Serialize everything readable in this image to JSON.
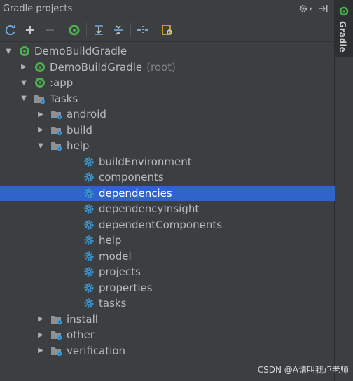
{
  "title": "Gradle projects",
  "side_tab": {
    "label": "Gradle"
  },
  "toolbar": {
    "buttons": [
      {
        "icon": "refresh-icon",
        "enabled": true
      },
      {
        "icon": "add-icon",
        "enabled": true
      },
      {
        "icon": "remove-icon",
        "enabled": false
      },
      {
        "icon": "execute-task-icon",
        "enabled": true
      },
      {
        "icon": "expand-all-icon",
        "enabled": true
      },
      {
        "icon": "collapse-all-icon",
        "enabled": true
      },
      {
        "icon": "offline-mode-icon",
        "enabled": true
      },
      {
        "icon": "settings-icon",
        "enabled": true
      }
    ]
  },
  "tree": [
    {
      "label": "DemoBuildGradle",
      "level": 0,
      "type": "gradle",
      "arrow": "expanded"
    },
    {
      "label": "DemoBuildGradle",
      "suffix": "(root)",
      "level": 1,
      "type": "gradle",
      "arrow": "collapsed"
    },
    {
      "label": ":app",
      "level": 1,
      "type": "gradle",
      "arrow": "expanded"
    },
    {
      "label": "Tasks",
      "level": 2,
      "type": "folder",
      "arrow": "expanded"
    },
    {
      "label": "android",
      "level": 3,
      "type": "folder",
      "arrow": "collapsed"
    },
    {
      "label": "build",
      "level": 3,
      "type": "folder",
      "arrow": "collapsed"
    },
    {
      "label": "help",
      "level": 3,
      "type": "folder",
      "arrow": "expanded"
    },
    {
      "label": "buildEnvironment",
      "level": 4,
      "type": "task"
    },
    {
      "label": "components",
      "level": 4,
      "type": "task"
    },
    {
      "label": "dependencies",
      "level": 4,
      "type": "task",
      "selected": true
    },
    {
      "label": "dependencyInsight",
      "level": 4,
      "type": "task"
    },
    {
      "label": "dependentComponents",
      "level": 4,
      "type": "task"
    },
    {
      "label": "help",
      "level": 4,
      "type": "task"
    },
    {
      "label": "model",
      "level": 4,
      "type": "task"
    },
    {
      "label": "projects",
      "level": 4,
      "type": "task"
    },
    {
      "label": "properties",
      "level": 4,
      "type": "task"
    },
    {
      "label": "tasks",
      "level": 4,
      "type": "task"
    },
    {
      "label": "install",
      "level": 3,
      "type": "folder",
      "arrow": "collapsed"
    },
    {
      "label": "other",
      "level": 3,
      "type": "folder",
      "arrow": "collapsed"
    },
    {
      "label": "verification",
      "level": 3,
      "type": "folder",
      "arrow": "collapsed"
    }
  ],
  "watermark": "CSDN @A请叫我卢老师",
  "colors": {
    "selection": "#2f65ca",
    "gradle_green": "#4caf50",
    "task_blue": "#3a9ad9"
  }
}
